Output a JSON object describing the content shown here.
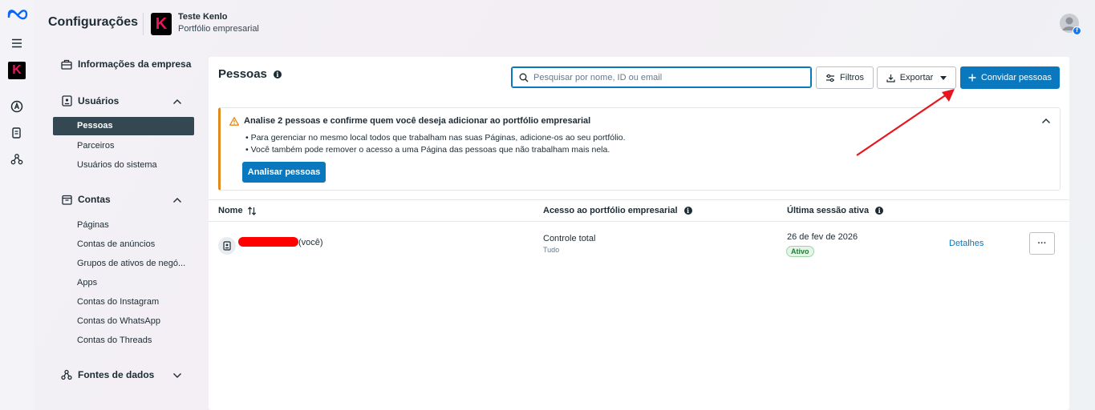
{
  "app": {
    "title": "Configurações",
    "business_name": "Teste Kenlo",
    "business_subtitle": "Portfólio empresarial",
    "business_logo_letter": "K"
  },
  "rail": {
    "icons": [
      "meta-logo-icon",
      "menu-icon",
      "business-logo-icon",
      "ads-icon",
      "pages-icon",
      "integrations-icon"
    ],
    "logo_letter": "K"
  },
  "sidebar": {
    "company_info": "Informações da empresa",
    "users": {
      "label": "Usuários",
      "items": [
        "Pessoas",
        "Parceiros",
        "Usuários do sistema"
      ],
      "active": "Pessoas"
    },
    "accounts": {
      "label": "Contas",
      "items": [
        "Páginas",
        "Contas de anúncios",
        "Grupos de ativos de negó...",
        "Apps",
        "Contas do Instagram",
        "Contas do WhatsApp",
        "Contas do Threads"
      ]
    },
    "data_sources": "Fontes de dados"
  },
  "main": {
    "title": "Pessoas",
    "search_placeholder": "Pesquisar por nome, ID ou email",
    "filters_label": "Filtros",
    "export_label": "Exportar",
    "invite_label": "Convidar pessoas",
    "alert": {
      "title": "Analise 2 pessoas e confirme quem você deseja adicionar ao portfólio empresarial",
      "lines": [
        "• Para gerenciar no mesmo local todos que trabalham nas suas Páginas, adicione-os ao seu portfólio.",
        "• Você também pode remover o acesso a uma Página das pessoas que não trabalham mais nela."
      ],
      "button": "Analisar pessoas"
    },
    "table": {
      "headers": [
        "Nome",
        "Acesso ao portfólio empresarial",
        "Última sessão ativa"
      ],
      "rows": [
        {
          "name_suffix": "(você)",
          "access": "Controle total",
          "access_detail": "Tudo",
          "last_session": "26 de fev de 2026",
          "status": "Ativo",
          "details_link": "Detalhes",
          "more": "···"
        }
      ]
    }
  },
  "colors": {
    "primary": "#0a78be",
    "warning": "#e08a1e",
    "annotation_arrow": "#e8141e",
    "redaction": "#ff0000"
  }
}
